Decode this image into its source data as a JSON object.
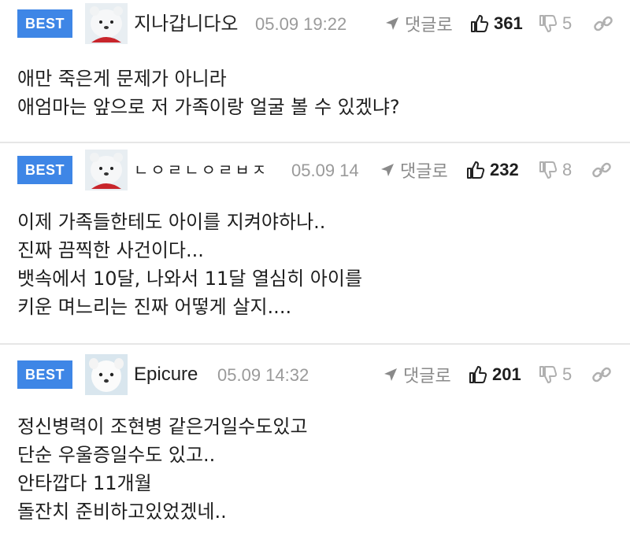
{
  "comments": [
    {
      "badge": "BEST",
      "nickname": "지나갑니다오",
      "date": "05.09 19:22",
      "reply_label": "댓글로",
      "likes": "361",
      "dislikes": "5",
      "lines": [
        "애만 죽은게 문제가 아니라",
        "애엄마는 앞으로 저 가족이랑 얼굴 볼 수 있겠냐?"
      ]
    },
    {
      "badge": "BEST",
      "nickname": "ㄴㅇㄹㄴㅇㄹㅂㅈ",
      "date": "05.09 14",
      "reply_label": "댓글로",
      "likes": "232",
      "dislikes": "8",
      "lines": [
        "이제 가족들한테도 아이를 지켜야하나..",
        "진짜 끔찍한 사건이다...",
        "뱃속에서 10달, 나와서 11달 열심히 아이를",
        "키운 며느리는 진짜 어떻게 살지...."
      ]
    },
    {
      "badge": "BEST",
      "nickname": "Epicure",
      "date": "05.09 14:32",
      "reply_label": "댓글로",
      "likes": "201",
      "dislikes": "5",
      "lines": [
        "정신병력이 조현병 같은거일수도있고",
        "단순 우울증일수도 있고..",
        "안타깝다 11개월",
        "돌잔치 준비하고있었겠네.."
      ]
    }
  ],
  "colors": {
    "badge": "#3e86e6",
    "date": "#9a9a9a",
    "divider": "#e6e6e6"
  },
  "icons": [
    "bear-avatar",
    "reply-arrow-icon",
    "thumbs-up-icon",
    "thumbs-down-icon",
    "link-icon"
  ]
}
